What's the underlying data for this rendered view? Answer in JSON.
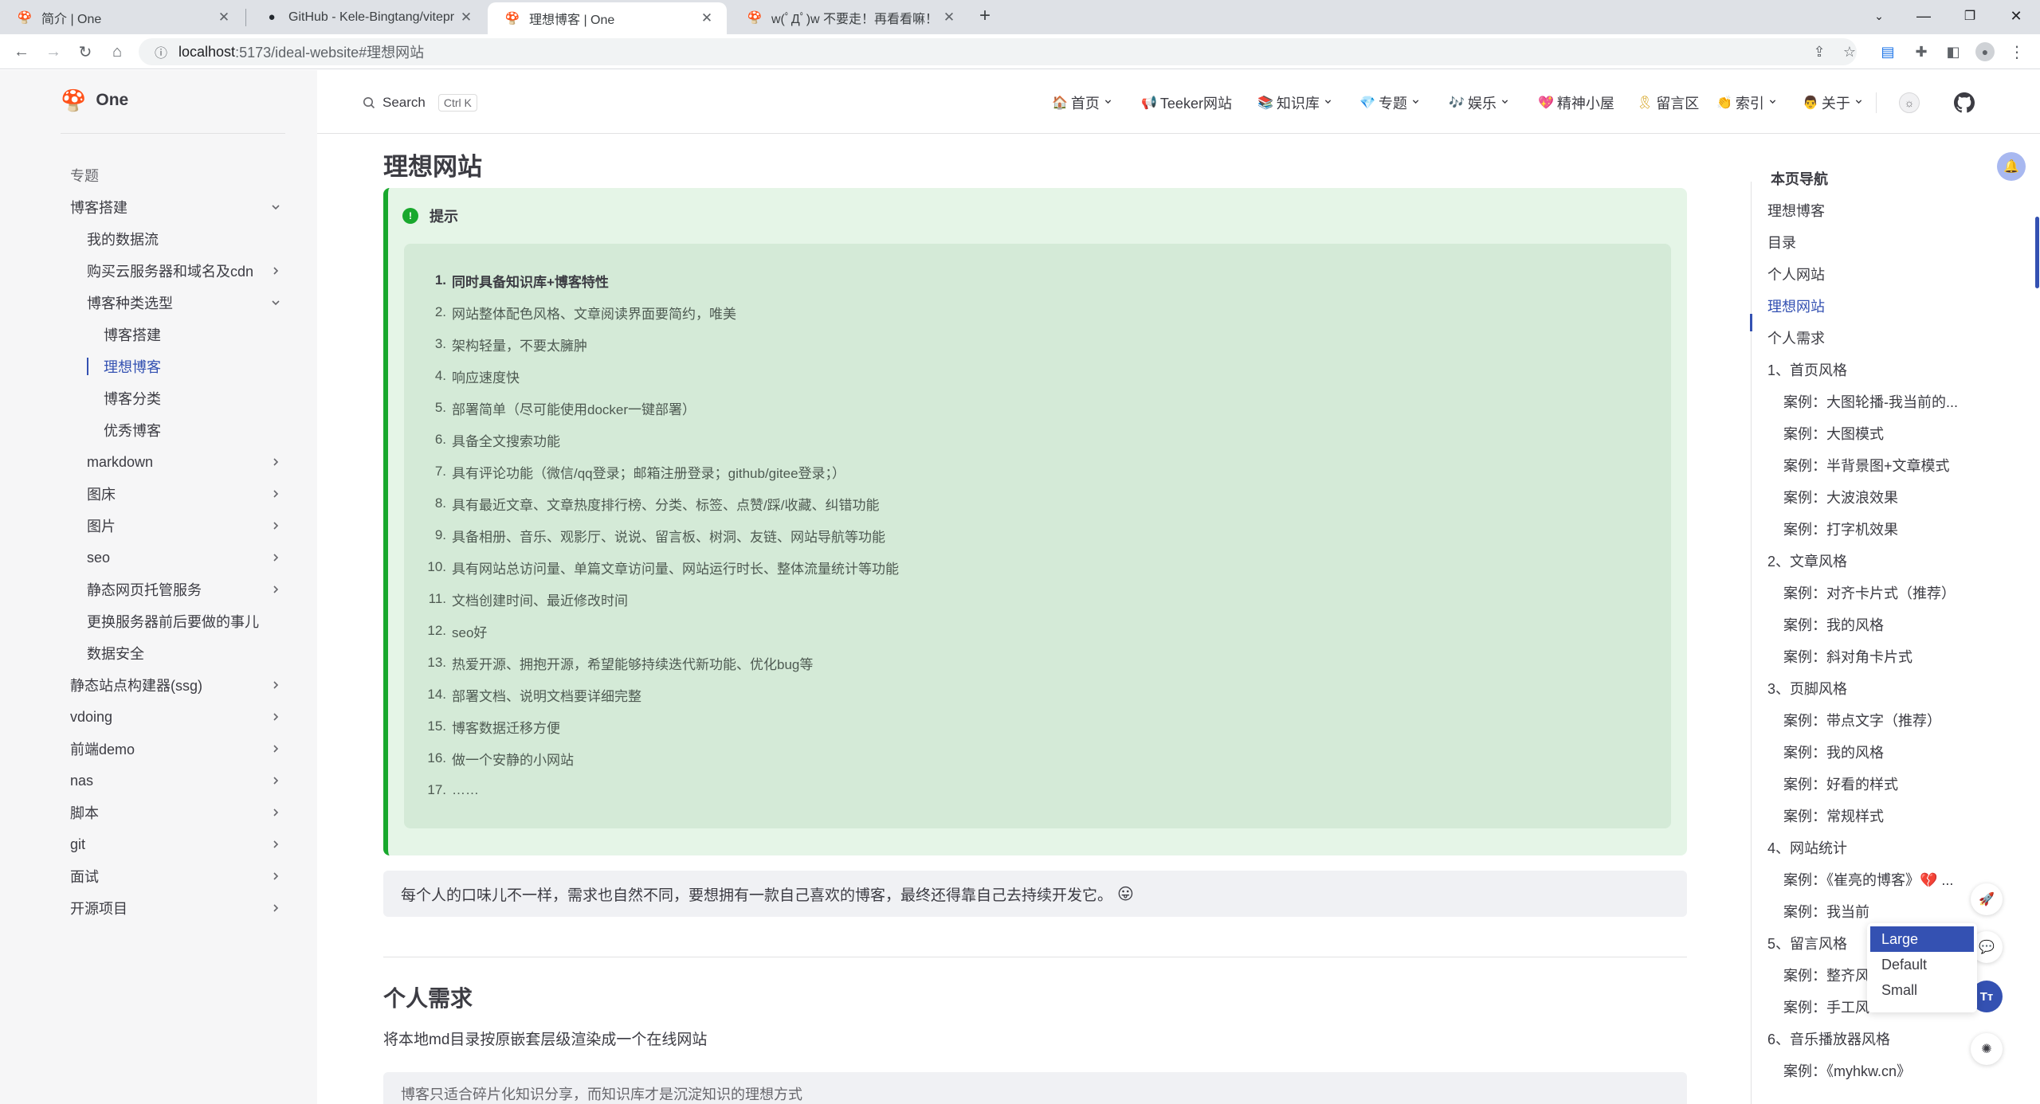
{
  "browser": {
    "tabs": [
      {
        "title": "简介 | One",
        "active": false
      },
      {
        "title": "GitHub - Kele-Bingtang/vitepr",
        "active": false
      },
      {
        "title": "理想博客 | One",
        "active": true
      },
      {
        "title": "w(ﾟДﾟ)w 不要走！再看看嘛！",
        "active": false
      }
    ],
    "new_tab": "+",
    "url_host": "localhost",
    "url_path": ":5173/ideal-website#理想网站"
  },
  "site": {
    "brand": "One",
    "search_label": "Search",
    "search_kbd": "Ctrl K",
    "nav": [
      {
        "label": "首页",
        "icon": "🏠",
        "dropdown": true
      },
      {
        "label": "Teeker网站",
        "icon": "📢",
        "dropdown": false
      },
      {
        "label": "知识库",
        "icon": "📚",
        "dropdown": true
      },
      {
        "label": "专题",
        "icon": "💎",
        "dropdown": true
      },
      {
        "label": "娱乐",
        "icon": "🎶",
        "dropdown": true
      },
      {
        "label": "精神小屋",
        "icon": "💖",
        "dropdown": false
      },
      {
        "label": "留言区",
        "icon": "🎗",
        "dropdown": false
      },
      {
        "label": "索引",
        "icon": "👏",
        "dropdown": true
      },
      {
        "label": "关于",
        "icon": "👨",
        "dropdown": true
      }
    ]
  },
  "sidebar": {
    "items": [
      {
        "label": "专题",
        "level": 0,
        "section": true
      },
      {
        "label": "博客搭建",
        "level": 0,
        "caret": "down"
      },
      {
        "label": "我的数据流",
        "level": 1
      },
      {
        "label": "购买云服务器和域名及cdn",
        "level": 1,
        "caret": "right"
      },
      {
        "label": "博客种类选型",
        "level": 1,
        "caret": "down"
      },
      {
        "label": "博客搭建",
        "level": 2
      },
      {
        "label": "理想博客",
        "level": 2,
        "active": true
      },
      {
        "label": "博客分类",
        "level": 2
      },
      {
        "label": "优秀博客",
        "level": 2
      },
      {
        "label": "markdown",
        "level": 1,
        "caret": "right"
      },
      {
        "label": "图床",
        "level": 1,
        "caret": "right"
      },
      {
        "label": "图片",
        "level": 1,
        "caret": "right"
      },
      {
        "label": "seo",
        "level": 1,
        "caret": "right"
      },
      {
        "label": "静态网页托管服务",
        "level": 1,
        "caret": "right"
      },
      {
        "label": "更换服务器前后要做的事儿",
        "level": 1
      },
      {
        "label": "数据安全",
        "level": 1
      },
      {
        "label": "静态站点构建器(ssg)",
        "level": 0,
        "caret": "right"
      },
      {
        "label": "vdoing",
        "level": 0,
        "caret": "right"
      },
      {
        "label": "前端demo",
        "level": 0,
        "caret": "right"
      },
      {
        "label": "nas",
        "level": 0,
        "caret": "right"
      },
      {
        "label": "脚本",
        "level": 0,
        "caret": "right"
      },
      {
        "label": "git",
        "level": 0,
        "caret": "right"
      },
      {
        "label": "面试",
        "level": 0,
        "caret": "right"
      },
      {
        "label": "开源项目",
        "level": 0,
        "caret": "right"
      }
    ]
  },
  "content": {
    "title": "理想网站",
    "tip_title": "提示",
    "tip_items": [
      "同时具备知识库+博客特性",
      "网站整体配色风格、文章阅读界面要简约，唯美",
      "架构轻量，不要太臃肿",
      "响应速度快",
      "部署简单（尽可能使用docker一键部署）",
      "具备全文搜索功能",
      "具有评论功能（微信/qq登录；邮箱注册登录；github/gitee登录；）",
      "具有最近文章、文章热度排行榜、分类、标签、点赞/踩/收藏、纠错功能",
      "具备相册、音乐、观影厅、说说、留言板、树洞、友链、网站导航等功能",
      "具有网站总访问量、单篇文章访问量、网站运行时长、整体流量统计等功能",
      "文档创建时间、最近修改时间",
      "seo好",
      "热爱开源、拥抱开源，希望能够持续迭代新功能、优化bug等",
      "部署文档、说明文档要详细完整",
      "博客数据迁移方便",
      "做一个安静的小网站",
      "……"
    ],
    "quote": "每个人的口味儿不一样，需求也自然不同，要想拥有一款自己喜欢的博客，最终还得靠自己去持续开发它。",
    "quote_emoji": "😛",
    "section2_title": "个人需求",
    "section2_para": "将本地md目录按原嵌套层级渲染成一个在线网站",
    "section2_block": "博客只适合碎片化知识分享，而知识库才是沉淀知识的理想方式"
  },
  "outline": {
    "title": "本页导航",
    "items": [
      {
        "label": "理想博客",
        "level": 1
      },
      {
        "label": "目录",
        "level": 1
      },
      {
        "label": "个人网站",
        "level": 1
      },
      {
        "label": "理想网站",
        "level": 1,
        "active": true
      },
      {
        "label": "个人需求",
        "level": 1
      },
      {
        "label": "1、首页风格",
        "level": 1
      },
      {
        "label": "案例：大图轮播-我当前的...",
        "level": 2
      },
      {
        "label": "案例：大图模式",
        "level": 2
      },
      {
        "label": "案例：半背景图+文章模式",
        "level": 2
      },
      {
        "label": "案例：大波浪效果",
        "level": 2
      },
      {
        "label": "案例：打字机效果",
        "level": 2
      },
      {
        "label": "2、文章风格",
        "level": 1
      },
      {
        "label": "案例：对齐卡片式（推荐）",
        "level": 2
      },
      {
        "label": "案例：我的风格",
        "level": 2
      },
      {
        "label": "案例：斜对角卡片式",
        "level": 2
      },
      {
        "label": "3、页脚风格",
        "level": 1
      },
      {
        "label": "案例：带点文字（推荐）",
        "level": 2
      },
      {
        "label": "案例：我的风格",
        "level": 2
      },
      {
        "label": "案例：好看的样式",
        "level": 2
      },
      {
        "label": "案例：常规样式",
        "level": 2
      },
      {
        "label": "4、网站统计",
        "level": 1
      },
      {
        "label": "案例：《崔亮的博客》💔 ...",
        "level": 2
      },
      {
        "label": "案例：我当前",
        "level": 2
      },
      {
        "label": "5、留言风格",
        "level": 1
      },
      {
        "label": "案例：整齐风",
        "level": 2
      },
      {
        "label": "案例：手工风格",
        "level": 2
      },
      {
        "label": "6、音乐播放器风格",
        "level": 1
      },
      {
        "label": "案例：《myhkw.cn》",
        "level": 2
      }
    ]
  },
  "font_size_menu": {
    "options": [
      "Large",
      "Default",
      "Small"
    ],
    "selected": "Large",
    "button_label": "Tт"
  },
  "colors": {
    "brand": "#3451b2",
    "tip_accent": "#18a82d",
    "tip_bg": "#e5f5e7"
  }
}
